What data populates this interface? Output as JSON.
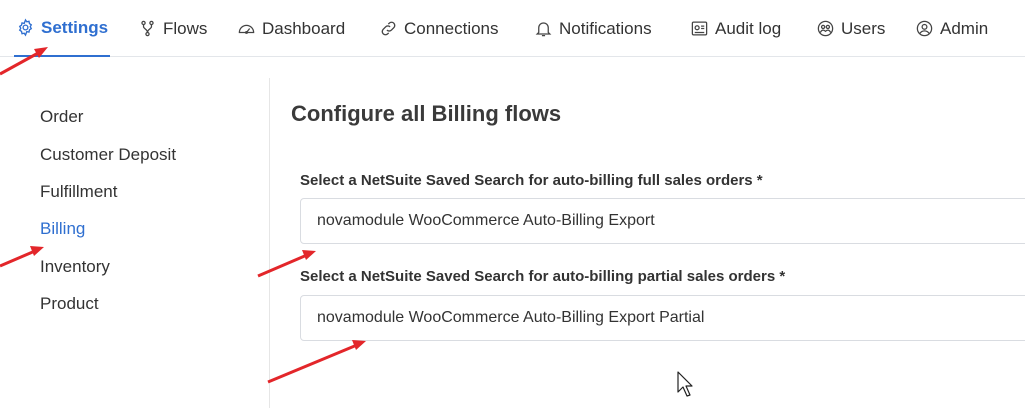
{
  "nav": {
    "tabs": [
      {
        "label": "Settings",
        "icon": "gear-icon"
      },
      {
        "label": "Flows",
        "icon": "flow-branch-icon"
      },
      {
        "label": "Dashboard",
        "icon": "gauge-icon"
      },
      {
        "label": "Connections",
        "icon": "link-icon"
      },
      {
        "label": "Notifications",
        "icon": "bell-icon"
      },
      {
        "label": "Audit log",
        "icon": "audit-log-icon"
      },
      {
        "label": "Users",
        "icon": "users-icon"
      },
      {
        "label": "Admin",
        "icon": "user-circle-icon"
      }
    ],
    "active_tab": "Settings"
  },
  "sidebar": {
    "items": [
      {
        "label": "Order"
      },
      {
        "label": "Customer Deposit"
      },
      {
        "label": "Fulfillment"
      },
      {
        "label": "Billing"
      },
      {
        "label": "Inventory"
      },
      {
        "label": "Product"
      }
    ],
    "active_item": "Billing"
  },
  "main": {
    "heading": "Configure all Billing flows",
    "fields": [
      {
        "label": "Select a NetSuite Saved Search for auto-billing full sales orders *",
        "value": "novamodule WooCommerce Auto-Billing Export"
      },
      {
        "label": "Select a NetSuite Saved Search for auto-billing partial sales orders *",
        "value": "novamodule WooCommerce Auto-Billing Export Partial"
      }
    ]
  },
  "colors": {
    "accent": "#2f6fd0",
    "annotation_arrow": "#e3262a",
    "text": "#333333",
    "border": "#d9dce1"
  }
}
